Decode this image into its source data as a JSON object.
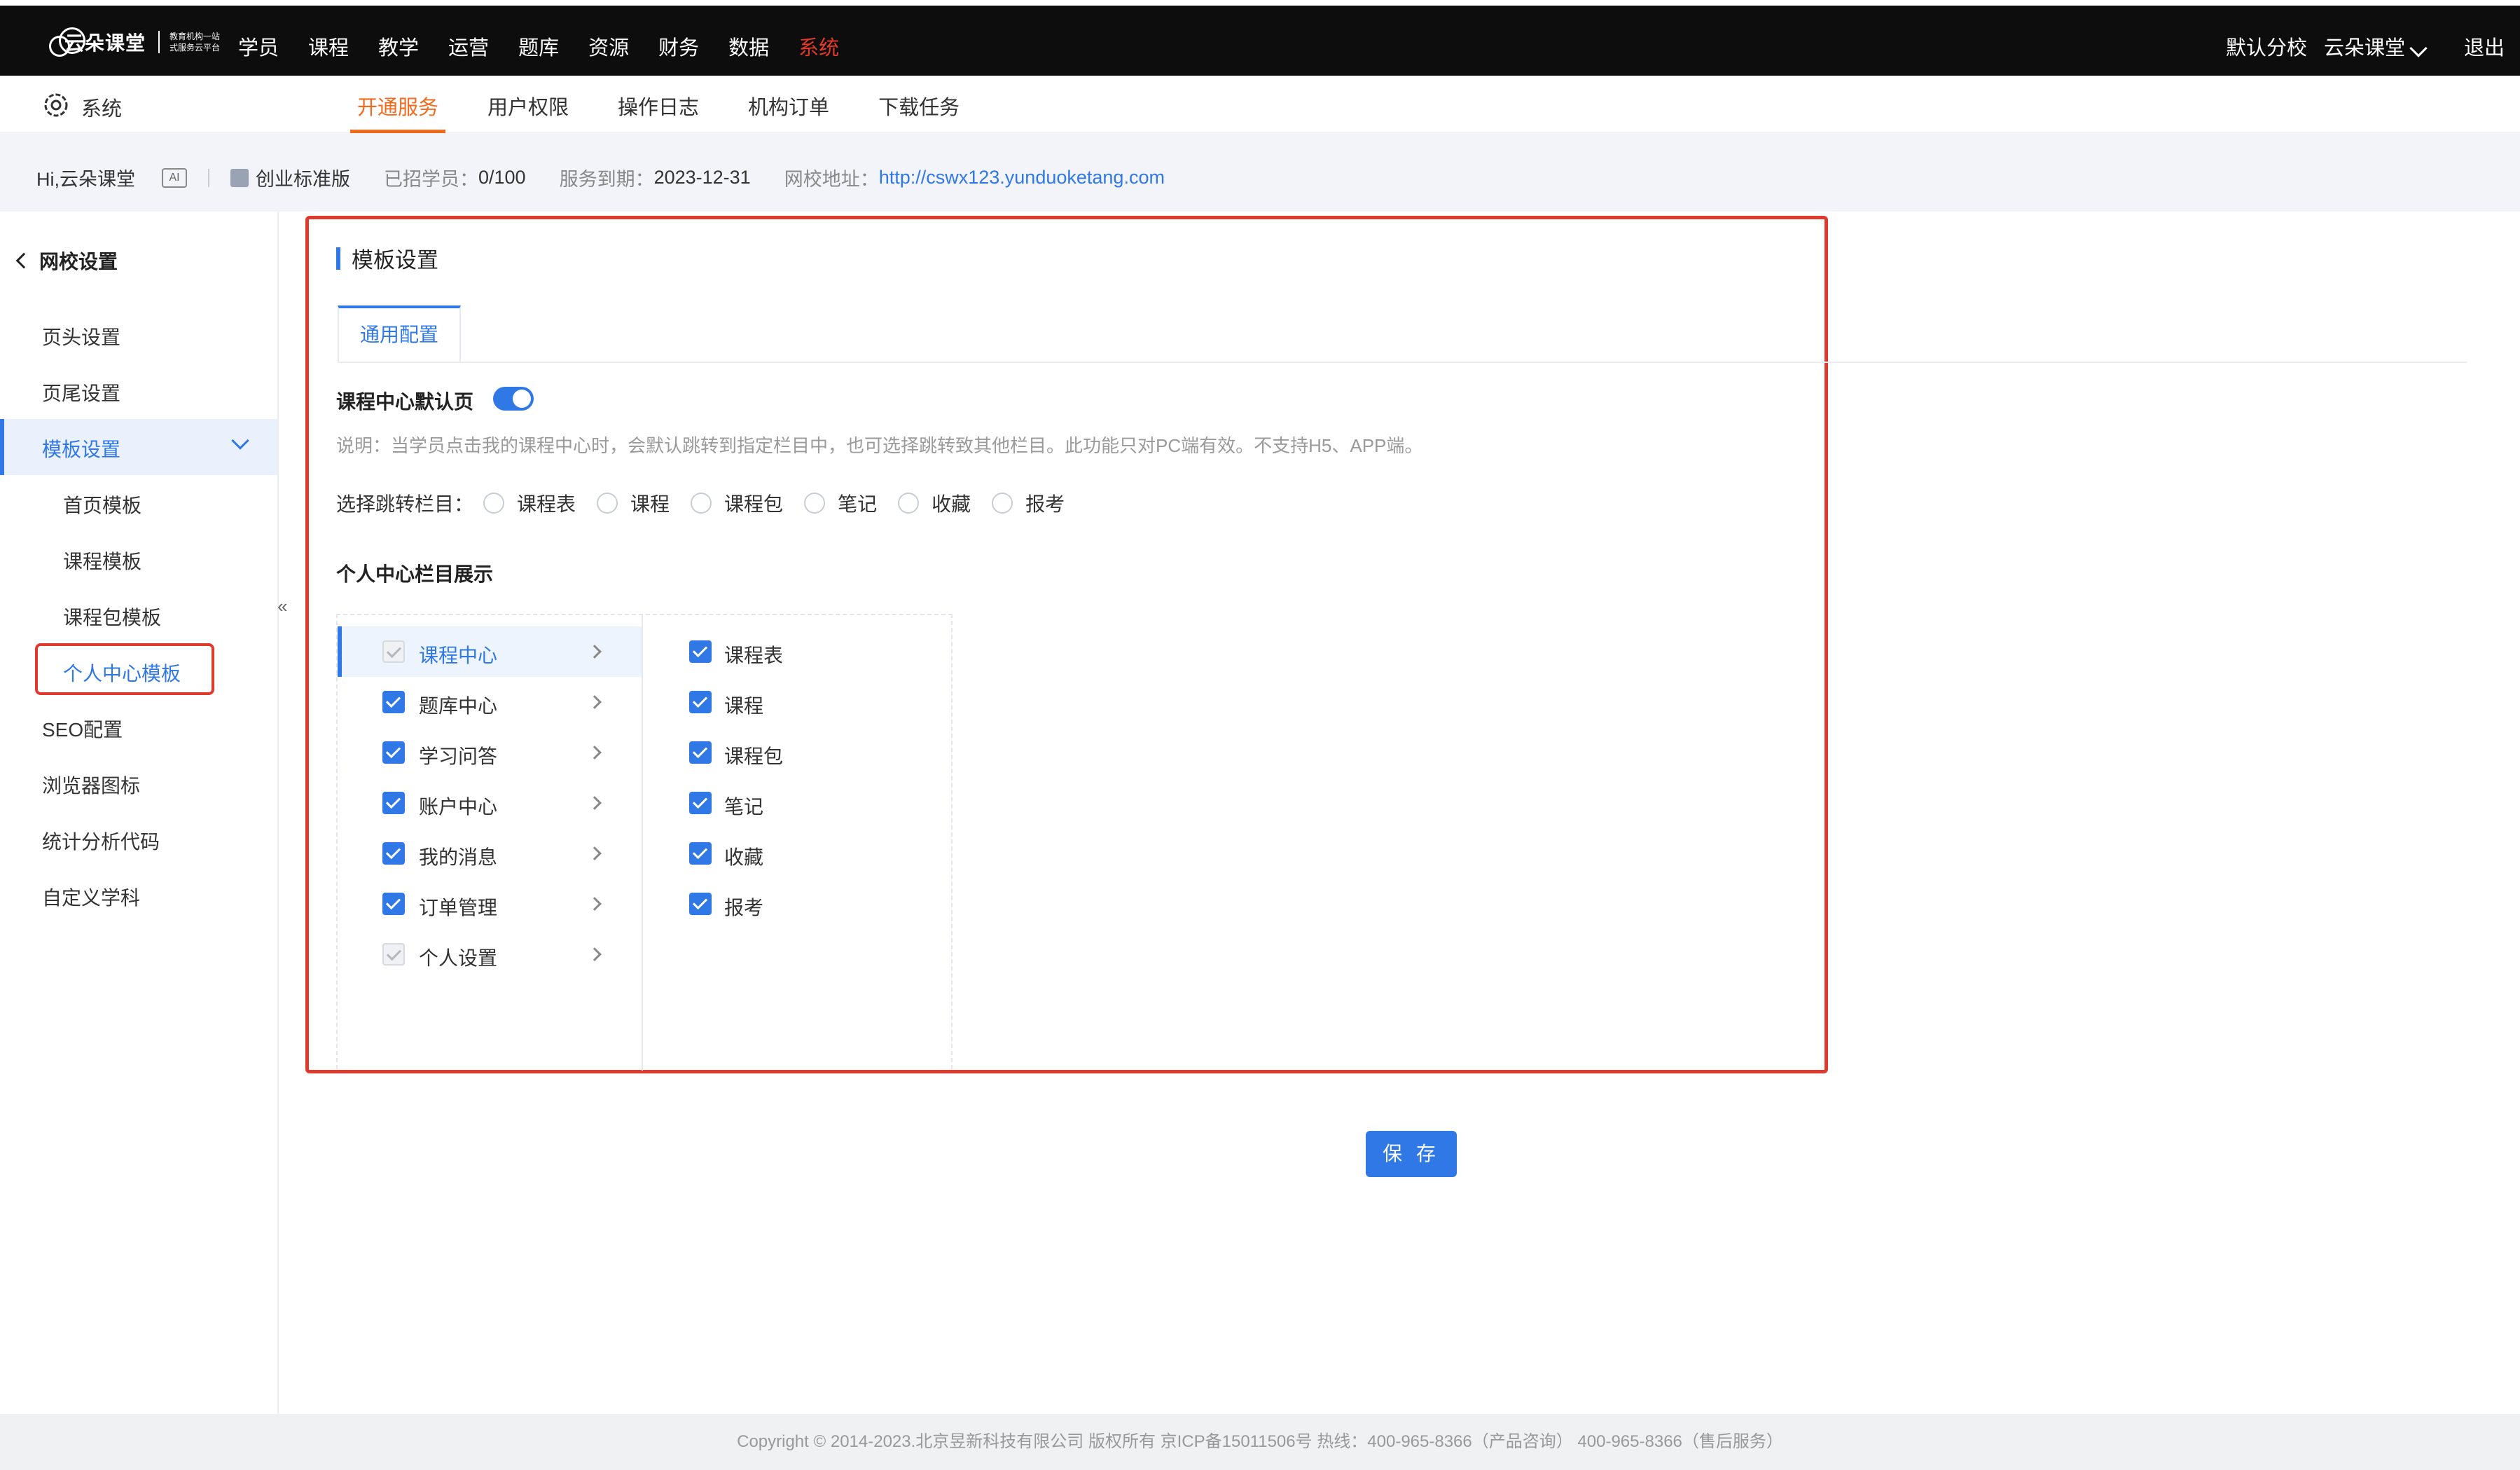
{
  "header": {
    "logo_text": "云朵课堂",
    "logo_subtitle_1": "教育机构一站",
    "logo_subtitle_2": "式服务云平台",
    "nav": [
      "学员",
      "课程",
      "教学",
      "运营",
      "题库",
      "资源",
      "财务",
      "数据",
      "系统"
    ],
    "active_nav": "系统",
    "branch": "默认分校",
    "user": "云朵课堂",
    "logout": "退出"
  },
  "subheader": {
    "section": "系统",
    "tabs": [
      "开通服务",
      "用户权限",
      "操作日志",
      "机构订单",
      "下载任务"
    ],
    "active_tab": "开通服务"
  },
  "info": {
    "greeting": "Hi,云朵课堂",
    "edition": "创业标准版",
    "students_label": "已招学员：",
    "students_value": "0/100",
    "expire_label": "服务到期：",
    "expire_value": "2023-12-31",
    "url_label": "网校地址：",
    "url_value": "http://cswx123.yunduoketang.com"
  },
  "sidebar": {
    "back_label": "网校设置",
    "items": [
      "页头设置",
      "页尾设置",
      "模板设置"
    ],
    "active_item": "模板设置",
    "sub_items": [
      "首页模板",
      "课程模板",
      "课程包模板",
      "个人中心模板"
    ],
    "active_sub": "个人中心模板",
    "more_items": [
      "SEO配置",
      "浏览器图标",
      "统计分析代码",
      "自定义学科"
    ],
    "collapse_glyph": "«"
  },
  "main": {
    "title": "模板设置",
    "tab": "通用配置",
    "default_page_label": "课程中心默认页",
    "default_page_enabled": true,
    "description": "说明：当学员点击我的课程中心时，会默认跳转到指定栏目中，也可选择跳转致其他栏目。此功能只对PC端有效。不支持H5、APP端。",
    "jump_label": "选择跳转栏目：",
    "jump_options": [
      "课程表",
      "课程",
      "课程包",
      "笔记",
      "收藏",
      "报考"
    ],
    "display_label": "个人中心栏目展示",
    "left_items": [
      {
        "label": "课程中心",
        "disabled": true,
        "selected": true
      },
      {
        "label": "题库中心",
        "disabled": false,
        "selected": false
      },
      {
        "label": "学习问答",
        "disabled": false,
        "selected": false
      },
      {
        "label": "账户中心",
        "disabled": false,
        "selected": false
      },
      {
        "label": "我的消息",
        "disabled": false,
        "selected": false
      },
      {
        "label": "订单管理",
        "disabled": false,
        "selected": false
      },
      {
        "label": "个人设置",
        "disabled": true,
        "selected": false
      }
    ],
    "right_items": [
      "课程表",
      "课程",
      "课程包",
      "笔记",
      "收藏",
      "报考"
    ],
    "save_label": "保 存"
  },
  "footer": {
    "text": "Copyright © 2014-2023.北京昱新科技有限公司 版权所有 京ICP备15011506号        热线：400-965-8366（产品咨询）  400-965-8366（售后服务）"
  },
  "colors": {
    "accent": "#2f78e6",
    "highlight_red": "#e03a2f",
    "tab_orange": "#f26a1b",
    "topbar": "#0d0d0d"
  }
}
